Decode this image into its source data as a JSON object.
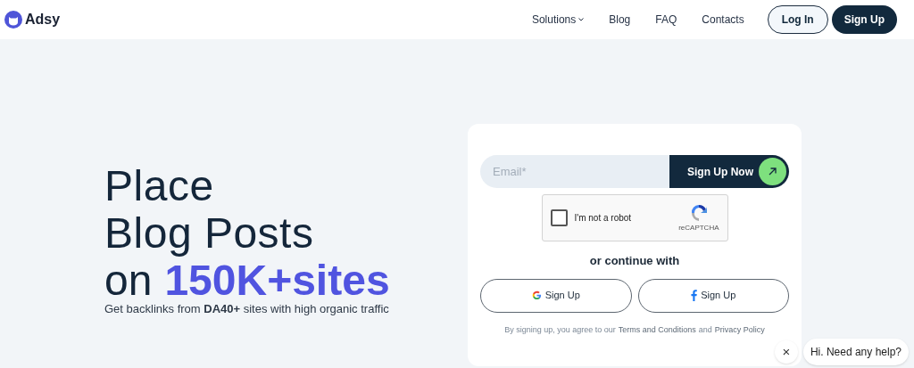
{
  "header": {
    "logo": "Adsy",
    "nav": [
      {
        "label": "Solutions",
        "dropdown": true
      },
      {
        "label": "Blog",
        "dropdown": false
      },
      {
        "label": "FAQ",
        "dropdown": false
      },
      {
        "label": "Contacts",
        "dropdown": false
      }
    ],
    "login": "Log In",
    "signup": "Sign Up"
  },
  "hero": {
    "lines": [
      "Place",
      "Blog Posts"
    ],
    "prefix": "on",
    "highlight": "150K+sites",
    "subtitle": "Get backlinks from **DA40+** sites with high organic traffic"
  },
  "form": {
    "email": {
      "placeholder": "Email*"
    },
    "submit": "Sign Up Now",
    "captcha": {
      "label": "I'm not a robot",
      "brand": "reCAPTCHA",
      "checked": false
    },
    "divider": "or continue with",
    "social": [
      {
        "kind": "google",
        "label": "Sign Up"
      },
      {
        "kind": "facebook",
        "label": "Sign Up"
      }
    ],
    "legal": {
      "before": "By signing up, you agree to our",
      "terms": "Terms and Conditions",
      "joiner": "and",
      "privacy": "Privacy Policy"
    }
  },
  "chat": {
    "close": "×",
    "message": "Hi. Need any help?"
  }
}
